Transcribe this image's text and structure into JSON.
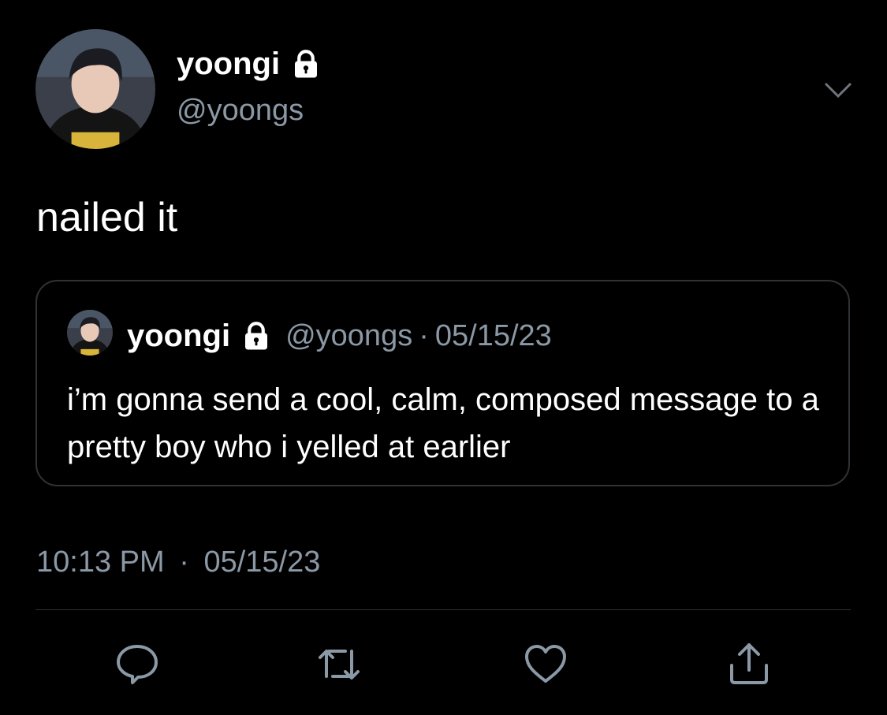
{
  "tweet": {
    "author": {
      "display_name": "yoongi",
      "handle": "@yoongs",
      "avatar_icon": "profile-photo",
      "protected_icon": "lock-icon"
    },
    "text": "nailed it",
    "timestamp": {
      "time": "10:13 PM",
      "separator": "·",
      "date": "05/15/23"
    }
  },
  "quoted_tweet": {
    "author": {
      "display_name": "yoongi",
      "handle": "@yoongs"
    },
    "separator": "·",
    "date": "05/15/23",
    "text": "i’m gonna send a cool, calm, composed message to a pretty boy who i yelled at earlier"
  },
  "actions": [
    "reply-icon",
    "retweet-icon",
    "like-icon",
    "share-icon"
  ],
  "colors": {
    "background": "#000000",
    "text": "#ffffff",
    "secondary_text": "#8b98a5",
    "border": "#2f3336"
  }
}
